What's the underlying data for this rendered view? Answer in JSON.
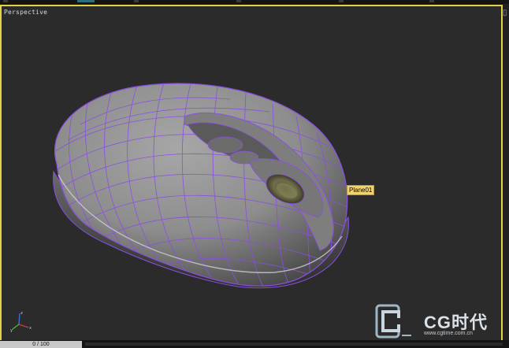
{
  "viewport": {
    "label": "Perspective",
    "active_border_color": "#e3d246",
    "background_color": "#2b2b2b"
  },
  "object": {
    "name_tag": "Plane01",
    "wireframe_color": "#8b4fe0",
    "shade_color": "#8c8c8c"
  },
  "timeline": {
    "frame_counter": "0 / 100"
  },
  "axis_gizmo": {
    "x_label": "x",
    "y_label": "y",
    "z_label": "z"
  },
  "watermark": {
    "brand": "CG时代",
    "url": "www.cgtime.com.cn"
  },
  "icons": [
    "corner-glyph-icon",
    "axis-gizmo-icon",
    "cg-logo-icon"
  ]
}
